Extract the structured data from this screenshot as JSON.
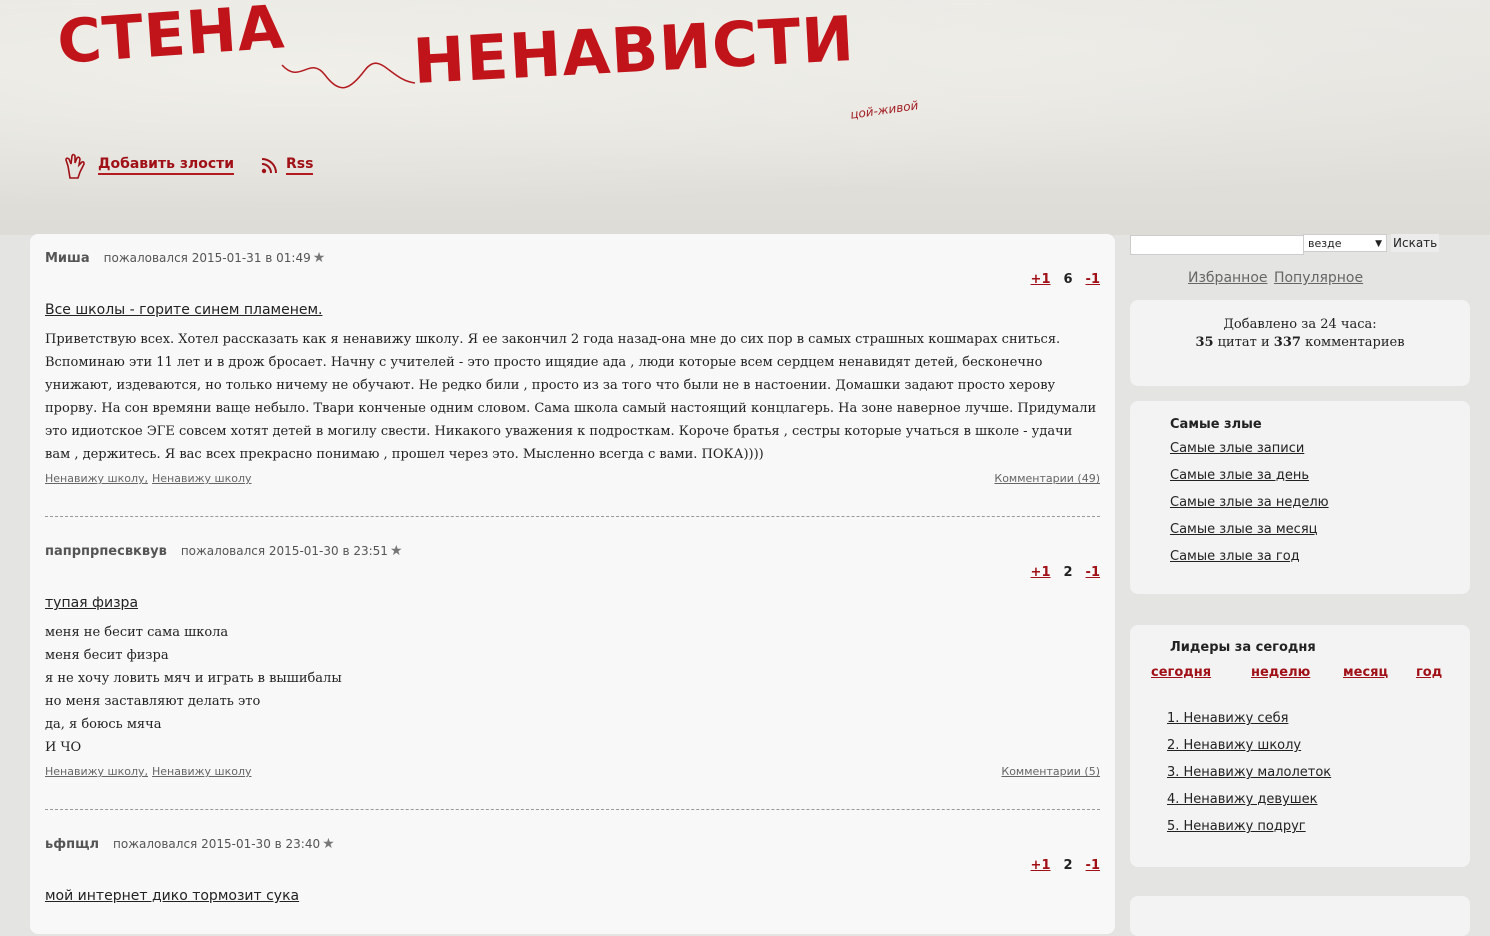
{
  "header": {
    "logo_word1": "СТЕНА",
    "logo_word2": "НЕНАВИСТИ",
    "tagline": "цой-живой",
    "add_link": "Добавить злости",
    "rss_link": "Rss"
  },
  "posts": [
    {
      "author": "Миша",
      "meta": "пожаловался 2015-01-31 в 01:49",
      "vote_up": "+1",
      "score": "6",
      "vote_down": "-1",
      "title": "Все школы - горите синем пламенем.",
      "body": "Приветствую всех. Хотел рассказать как я ненавижу школу. Я ее закончил 2 года назад-она мне до сих пор в самых страшных кошмарах сниться. Вспоминаю эти 11 лет и в дрож бросает. Начну с учителей - это просто ищядие ада , люди которые всем сердцем ненавидят детей, бесконечно унижают, издеваются, но только ничему не обучают. Не редко били , просто из за того что были не в настоении. Домашки задают просто херову прорву. На сон времяни ваще небыло. Твари конченые одним словом. Сама школа самый настоящий концлагерь. На зоне наверное лучше. Придумали это идиотское ЭГЕ совсем хотят детей в могилу свести. Никакого уважения к подросткам. Короче братья , сестры которые учаться в школе - удачи вам , держитесь. Я вас всех прекрасно понимаю , прошел через это. Мысленно всегда с вами. ПОКА))))",
      "tag1": "Ненавижу школу,",
      "tag2": "Ненавижу школу",
      "comments": "Комментарии (49)"
    },
    {
      "author": "папрпрпесвквув",
      "meta": "пожаловался 2015-01-30 в 23:51",
      "vote_up": "+1",
      "score": "2",
      "vote_down": "-1",
      "title": "тупая физра",
      "lines": [
        "меня не бесит сама школа",
        "меня бесит физра",
        "я не хочу ловить мяч и играть в вышибалы",
        "но меня заставляют делать это",
        "да, я боюсь мяча",
        "И ЧО"
      ],
      "tag1": "Ненавижу школу,",
      "tag2": "Ненавижу школу",
      "comments": "Комментарии (5)"
    },
    {
      "author": "ьфпщл",
      "meta": "пожаловался 2015-01-30 в 23:40",
      "vote_up": "+1",
      "score": "2",
      "vote_down": "-1",
      "title": "мой интернет дико тормозит сука"
    }
  ],
  "sidebar": {
    "search_value": "",
    "search_scope": "везде",
    "search_button": "Искать",
    "favorites": "Избранное",
    "popular": "Популярное",
    "stats_line1": "Добавлено за 24 часа:",
    "stats_quotes_num": "35",
    "stats_quotes_label": "цитат и",
    "stats_comments_num": "337",
    "stats_comments_label": "комментариев",
    "evil_title": "Самые злые",
    "evil_links": [
      "Самые злые записи",
      "Самые злые за день",
      "Самые злые за неделю",
      "Самые злые за месяц",
      "Самые злые за год"
    ],
    "leaders_title": "Лидеры за сегодня",
    "leader_tabs": [
      "сегодня",
      "неделю",
      "месяц",
      "год"
    ],
    "leaders": [
      "1. Ненавижу себя",
      "2. Ненавижу школу",
      "3. Ненавижу малолеток",
      "4. Ненавижу девушек",
      "5. Ненавижу подруг"
    ]
  },
  "colors": {
    "accent": "#c0141a",
    "link_red": "#a01016"
  }
}
